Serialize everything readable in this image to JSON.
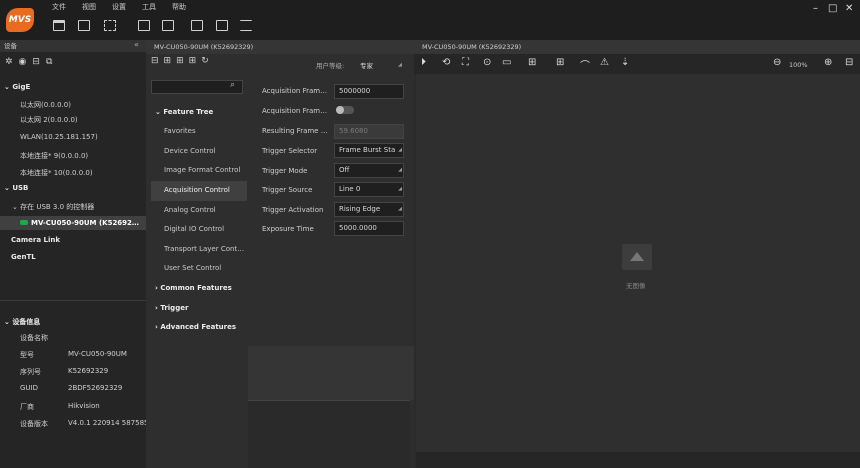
{
  "app": {
    "logo_text": "MVS",
    "accent": "#e96b1f"
  },
  "menu": [
    "文件",
    "视图",
    "设置",
    "工具",
    "帮助"
  ],
  "window_controls": [
    "–",
    "□",
    "✕"
  ],
  "toolbar_icons": [
    "folder-open-icon",
    "save-icon",
    "export-icon",
    "record-icon",
    "window-icon",
    "histogram-icon",
    "grid-icon",
    "list-icon"
  ],
  "left_panel": {
    "title": "设备",
    "collapse": "«",
    "groups": {
      "gige": "GigE",
      "usb": "USB",
      "camera_link": "Camera Link",
      "gentl": "GenTL"
    },
    "gige_items": [
      "以太网(0.0.0.0)",
      "以太网 2(0.0.0.0)",
      "WLAN(10.25.181.157)",
      "本地连接* 9(0.0.0.0)",
      "本地连接* 10(0.0.0.0)"
    ],
    "usb_controller": "存在 USB 3.0 的控制器",
    "usb_device": "MV-CU050-90UM (K52692…",
    "info_title": "设备信息",
    "info_rows": [
      {
        "label": "设备名称",
        "value": ""
      },
      {
        "label": "型号",
        "value": "MV-CU050-90UM"
      },
      {
        "label": "序列号",
        "value": "K52692329"
      },
      {
        "label": "GUID",
        "value": "2BDF52692329"
      },
      {
        "label": "厂商",
        "value": "Hikvision"
      },
      {
        "label": "设备版本",
        "value": "V4.0.1 220914 587585"
      }
    ]
  },
  "feature_panel": {
    "header": "MV-CU050-90UM (K52692329)",
    "user_level_label": "用户等级:",
    "user_level_value": "专家",
    "tree_title": "Feature Tree",
    "tree_items": [
      "Favorites",
      "Device Control",
      "Image Format Control",
      "Acquisition Control",
      "Analog Control",
      "Digital IO Control",
      "Transport Layer Cont…",
      "User Set Control"
    ],
    "tree_groups": [
      "Common Features",
      "Trigger",
      "Advanced Features"
    ],
    "selected_item": "Acquisition Control",
    "params": [
      {
        "label": "Acquisition Fram…",
        "value": "5000000"
      },
      {
        "label": "Acquisition Fram…",
        "value": ""
      },
      {
        "label": "Resulting Frame …",
        "value": "59.6080"
      },
      {
        "label": "Trigger Selector",
        "value": "Frame Burst Sta"
      },
      {
        "label": "Trigger Mode",
        "value": "Off"
      },
      {
        "label": "Trigger Source",
        "value": "Line 0"
      },
      {
        "label": "Trigger Activation",
        "value": "Rising Edge"
      },
      {
        "label": "Exposure Time",
        "value": "5000.0000"
      }
    ]
  },
  "image_panel": {
    "header": "MV-CU050-90UM (K52692329)",
    "zoom": "100%",
    "placeholder_text": "无图像"
  }
}
